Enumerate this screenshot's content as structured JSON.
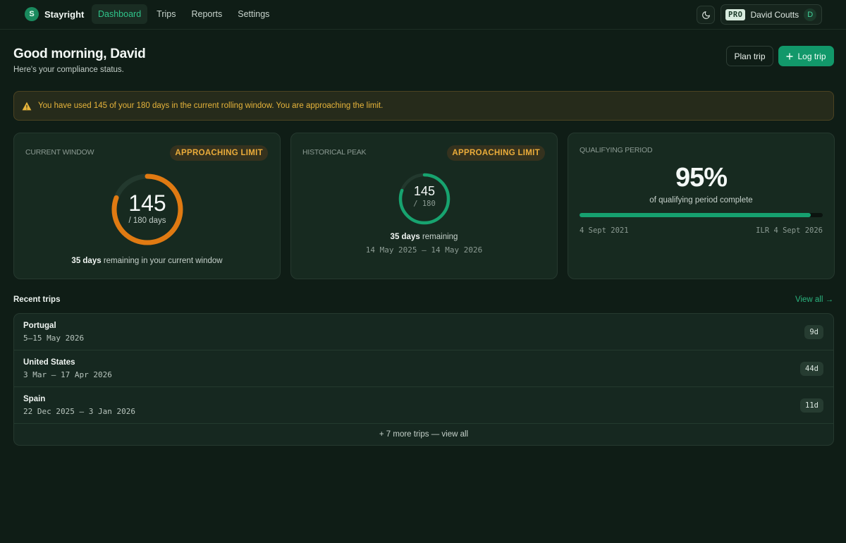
{
  "app": {
    "logo_letter": "S",
    "name": "Stayright"
  },
  "nav": {
    "items": [
      {
        "label": "Dashboard",
        "active": true
      },
      {
        "label": "Trips",
        "active": false
      },
      {
        "label": "Reports",
        "active": false
      },
      {
        "label": "Settings",
        "active": false
      }
    ]
  },
  "user": {
    "plan_badge": "PRO",
    "name": "David Coutts",
    "initial": "D"
  },
  "header": {
    "greeting": "Good morning, David",
    "subtitle": "Here's your compliance status.",
    "plan_trip_label": "Plan trip",
    "log_trip_label": "Log trip"
  },
  "alert": {
    "text": "You have used 145 of your 180 days in the current rolling window. You are approaching the limit."
  },
  "current_window": {
    "label": "CURRENT WINDOW",
    "badge": "APPROACHING LIMIT",
    "used": "145",
    "total_text": "/ 180 days",
    "fraction": 0.806,
    "remaining_days": "35 days",
    "remaining_suffix": " remaining in your current window",
    "color": "#e07a12"
  },
  "historical_peak": {
    "label": "HISTORICAL PEAK",
    "badge": "APPROACHING LIMIT",
    "used": "145",
    "total_text": "/ 180",
    "fraction": 0.806,
    "remaining_days": "35 days",
    "remaining_suffix": " remaining",
    "range": "14 May 2025 – 14 May 2026",
    "color": "#17a36f"
  },
  "qualifying": {
    "label": "QUALIFYING PERIOD",
    "percent": "95%",
    "fraction": 0.95,
    "caption": "of qualifying period complete",
    "start": "4 Sept 2021",
    "end": "ILR 4 Sept 2026"
  },
  "trips": {
    "title": "Recent trips",
    "view_all": "View all →",
    "rows": [
      {
        "country": "Portugal",
        "dates": "5–15 May 2026",
        "days": "9d"
      },
      {
        "country": "United States",
        "dates": "3 Mar – 17 Apr 2026",
        "days": "44d"
      },
      {
        "country": "Spain",
        "dates": "22 Dec 2025 – 3 Jan 2026",
        "days": "11d"
      }
    ],
    "more": "+ 7 more trips — view all"
  },
  "colors": {
    "accent": "#17a36f",
    "warning": "#e07a12",
    "alert_text": "#e7b43b"
  }
}
